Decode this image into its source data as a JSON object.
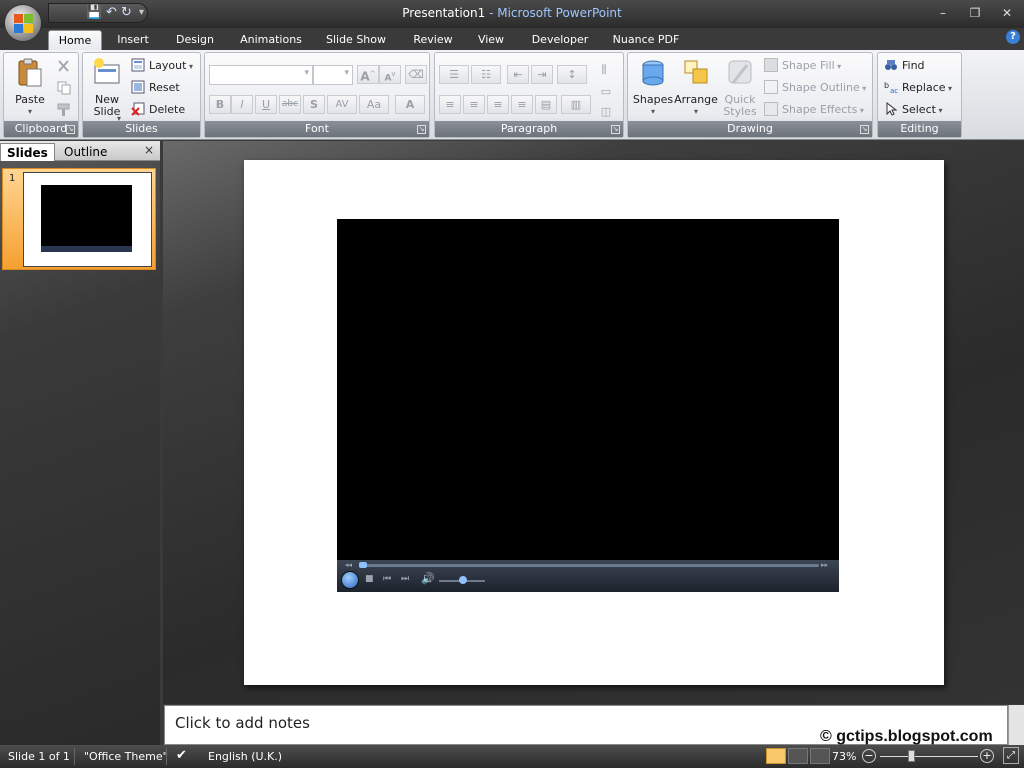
{
  "window": {
    "doc_name": "Presentation1",
    "separator": " - ",
    "app_name": "Microsoft PowerPoint"
  },
  "window_controls": {
    "minimize": "–",
    "restore": "❐",
    "close": "✕"
  },
  "qat": {
    "save": "💾",
    "undo": "↶",
    "redo": "↻",
    "customize": "▾"
  },
  "tabs": [
    "Home",
    "Insert",
    "Design",
    "Animations",
    "Slide Show",
    "Review",
    "View",
    "Developer",
    "Nuance PDF"
  ],
  "help": "?",
  "ribbon": {
    "clipboard": {
      "label": "Clipboard",
      "paste": "Paste"
    },
    "slides": {
      "label": "Slides",
      "new_slide": "New Slide",
      "layout": "Layout",
      "reset": "Reset",
      "delete": "Delete"
    },
    "font": {
      "label": "Font",
      "buttons": [
        "B",
        "I",
        "U",
        "abc",
        "S",
        "AV",
        "Aa",
        "A"
      ],
      "grow": "A",
      "shrink": "A"
    },
    "paragraph": {
      "label": "Paragraph"
    },
    "drawing": {
      "label": "Drawing",
      "shapes": "Shapes",
      "arrange": "Arrange",
      "quick_styles": "Quick Styles",
      "shape_fill": "Shape Fill",
      "shape_outline": "Shape Outline",
      "shape_effects": "Shape Effects"
    },
    "editing": {
      "label": "Editing",
      "find": "Find",
      "replace": "Replace",
      "select": "Select"
    }
  },
  "left_pane": {
    "tab_slides": "Slides",
    "tab_outline": "Outline",
    "close": "×",
    "slide_number": "1"
  },
  "notes": {
    "placeholder": "Click to add notes"
  },
  "watermark": "© gctips.blogspot.com",
  "status": {
    "slide": "Slide 1 of 1",
    "theme": "\"Office Theme\"",
    "language": "English (U.K.)",
    "zoom": "73%",
    "zoom_out": "−",
    "zoom_in": "+"
  },
  "colors": {
    "accent": "#f5a030",
    "titlebar": "#2b2b2b",
    "app_title": "#9fc6ff"
  }
}
